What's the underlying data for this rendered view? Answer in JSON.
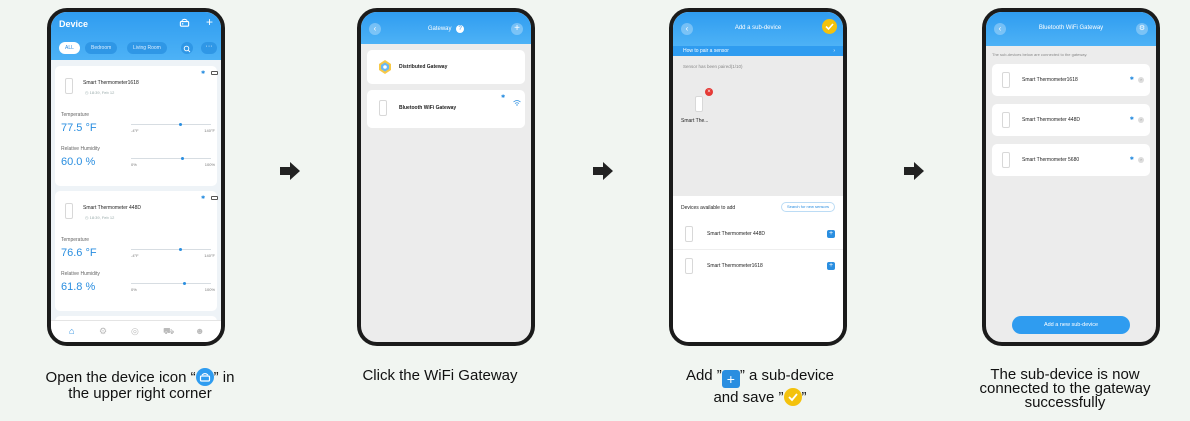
{
  "colors": {
    "accent": "#2a8ee0",
    "header": "#2f9cf0",
    "save_badge": "#f4c20d",
    "alert": "#e53935"
  },
  "phone1": {
    "title": "Device",
    "icons": {
      "add_device": "gateway-icon",
      "add": "plus-icon"
    },
    "tabs": [
      "ALL",
      "Bedroom",
      "Living Room"
    ],
    "devices": [
      {
        "name": "Smart Thermometer1618",
        "time": "18:39, Feb 12",
        "temp_label": "Temperature",
        "temp": "77.5 °F",
        "temp_min": "-4°F",
        "temp_max": "140°F",
        "hum_label": "Relative Humidity",
        "hum": "60.0 %",
        "hum_min": "0%",
        "hum_max": "100%"
      },
      {
        "name": "Smart Thermometer 448D",
        "time": "18:39, Feb 12",
        "temp_label": "Temperature",
        "temp": "76.6 °F",
        "temp_min": "-4°F",
        "temp_max": "140°F",
        "hum_label": "Relative Humidity",
        "hum": "61.8 %",
        "hum_min": "0%",
        "hum_max": "100%"
      }
    ]
  },
  "phone2": {
    "title": "Gateway",
    "items": [
      {
        "label": "Distributed Gateway"
      },
      {
        "label": "Bluetooth WiFi Gateway"
      }
    ]
  },
  "phone3": {
    "title": "Add a sub-device",
    "how_to": "How to pair a sensor",
    "paired_status": "Sensor has been paired(1/10)",
    "paired_device": "Smart The...",
    "available_label": "Devices available to add",
    "search_button": "Search for new sensors",
    "available": [
      "Smart Thermometer 448D",
      "Smart Thermometer1618"
    ]
  },
  "phone4": {
    "title": "Bluetooth WiFi Gateway",
    "subtitle": "The sub-devices below are connected to the gateway.",
    "devices": [
      "Smart Thermometer1618",
      "Smart Thermometer 448D",
      "Smart Thermometer 5680"
    ],
    "add_button": "Add a new sub-device"
  },
  "captions": {
    "c1_pre": "Open the device icon “",
    "c1_post": "” in",
    "c1_line2": "the upper right corner",
    "c2": "Click the WiFi Gateway",
    "c3_pre": "Add ”",
    "c3_post": "” a sub-device",
    "c3_line2_pre": "and save ”",
    "c3_line2_post": "”",
    "c4_line1": "The sub-device is now",
    "c4_line2": "connected to the gateway",
    "c4_line3": "successfully"
  }
}
